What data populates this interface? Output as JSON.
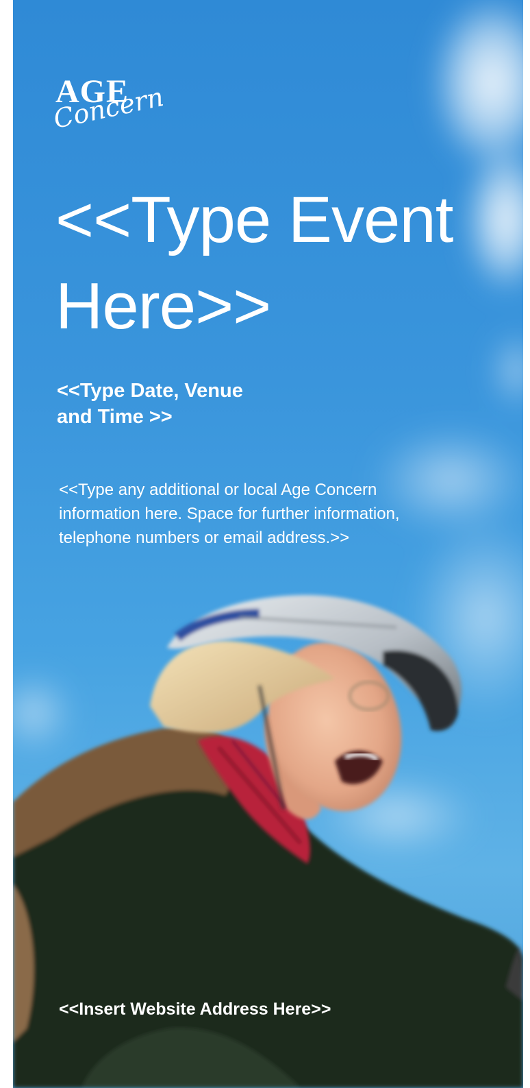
{
  "logo": {
    "top_word": "AGE",
    "script_word": "Concern"
  },
  "event": {
    "title_line1": "<<Type Event",
    "title_line2": "Here>>"
  },
  "details": {
    "date_line1": "<<Type Date, Venue",
    "date_line2": "and Time >>"
  },
  "additional": {
    "line1": "<<Type any additional or local Age Concern",
    "line2": "information here. Space for further information,",
    "line3": "telephone numbers or email address.>>"
  },
  "footer": {
    "website": "<<Insert Website Address Here>>"
  },
  "colors": {
    "sky": "#3a95dc",
    "text": "#ffffff",
    "jacket": "#1b2a1e",
    "vest": "#7a5a3a",
    "helmet": "#c9ced3",
    "scarf": "#b8203a"
  },
  "icons": {
    "logo": "age-concern-logo"
  }
}
